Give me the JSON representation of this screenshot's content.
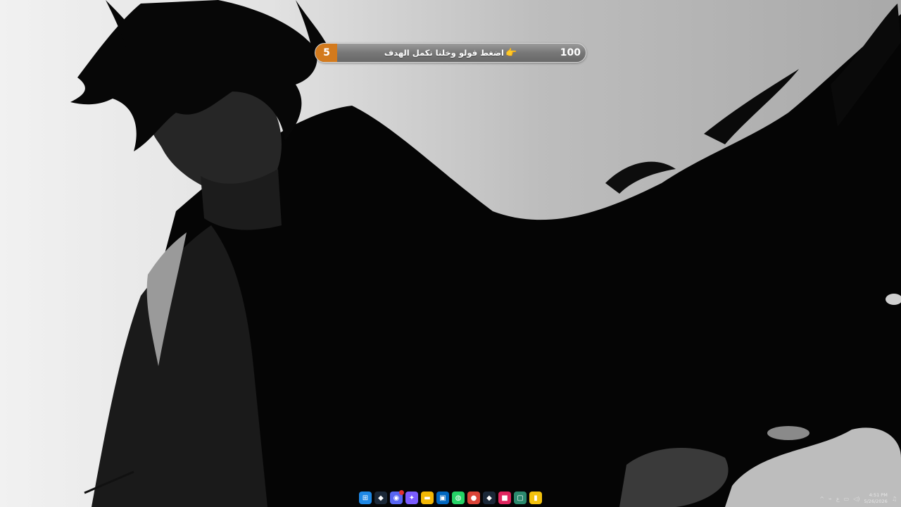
{
  "goal_widget": {
    "current_value": "5",
    "target_value": "100",
    "progress_fraction": 0.05,
    "label": "اضغط فولو وخلنا نكمل الهدف",
    "emoji": "👉",
    "fill_color": "#d37a1d"
  },
  "taskbar": {
    "icons": [
      {
        "name": "start-icon",
        "glyph": "⊞",
        "bg": "#1e88e5"
      },
      {
        "name": "steam-icon",
        "glyph": "◆",
        "bg": "#1b2838"
      },
      {
        "name": "discord-icon",
        "glyph": "◉",
        "bg": "#5865f2"
      },
      {
        "name": "copilot-icon",
        "glyph": "✦",
        "bg": "#7b5cff"
      },
      {
        "name": "file-explorer-icon",
        "glyph": "▬",
        "bg": "#f2b705"
      },
      {
        "name": "store-icon",
        "glyph": "▣",
        "bg": "#0067c0"
      },
      {
        "name": "whatsapp-icon",
        "glyph": "◍",
        "bg": "#25d366"
      },
      {
        "name": "chrome-icon",
        "glyph": "●",
        "bg": "#db4437"
      },
      {
        "name": "steam-2-icon",
        "glyph": "◆",
        "bg": "#1b2838"
      },
      {
        "name": "app-red-icon",
        "glyph": "■",
        "bg": "#e0245e"
      },
      {
        "name": "app-green-icon",
        "glyph": "▢",
        "bg": "#2b8a6e"
      },
      {
        "name": "app-yellow-icon",
        "glyph": "▮",
        "bg": "#f4c20d"
      }
    ],
    "tray": {
      "chevron": "^",
      "input_indicator": "ع",
      "time": "4:51 PM",
      "date": "5/26/2026"
    }
  }
}
